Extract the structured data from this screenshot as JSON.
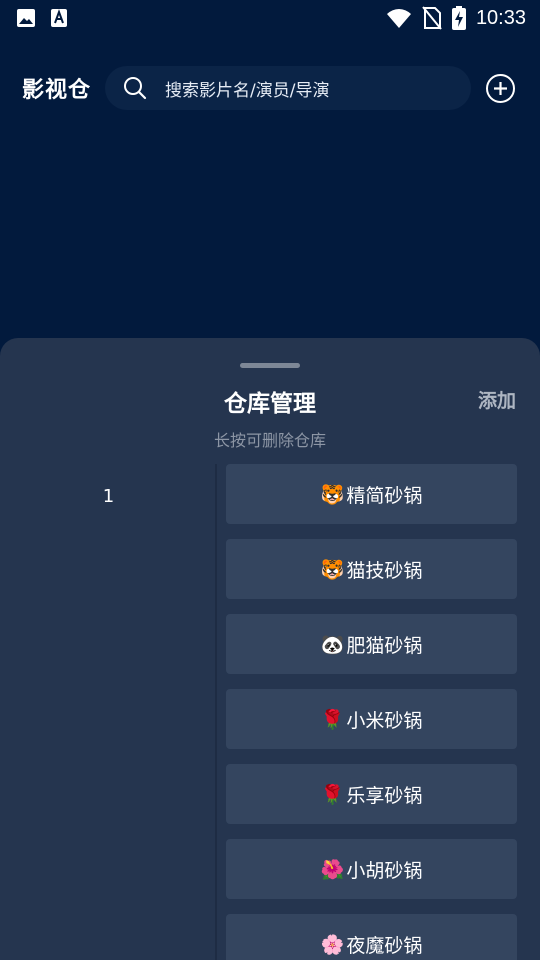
{
  "status_bar": {
    "time": "10:33",
    "icons": [
      "image-icon",
      "text-a-icon",
      "wifi-icon",
      "no-sim-icon",
      "battery-charging-icon"
    ]
  },
  "header": {
    "title": "影视仓",
    "search_placeholder": "搜索影片名/演员/导演",
    "add_icon": "plus-circle-icon"
  },
  "sheet": {
    "title": "仓库管理",
    "add_label": "添加",
    "subtitle": "长按可删除仓库",
    "group_number": "1",
    "items": [
      {
        "emoji": "🐯",
        "name": "精简砂锅"
      },
      {
        "emoji": "🐯",
        "name": "猫技砂锅"
      },
      {
        "emoji": "🐼",
        "name": "肥猫砂锅"
      },
      {
        "emoji": "🌹",
        "name": "小米砂锅"
      },
      {
        "emoji": "🌹",
        "name": "乐享砂锅"
      },
      {
        "emoji": "🌺",
        "name": "小胡砂锅"
      },
      {
        "emoji": "🌸",
        "name": "夜魔砂锅"
      }
    ]
  },
  "colors": {
    "background": "#021a3d",
    "sheet": "#25354f",
    "item": "#34455f"
  }
}
